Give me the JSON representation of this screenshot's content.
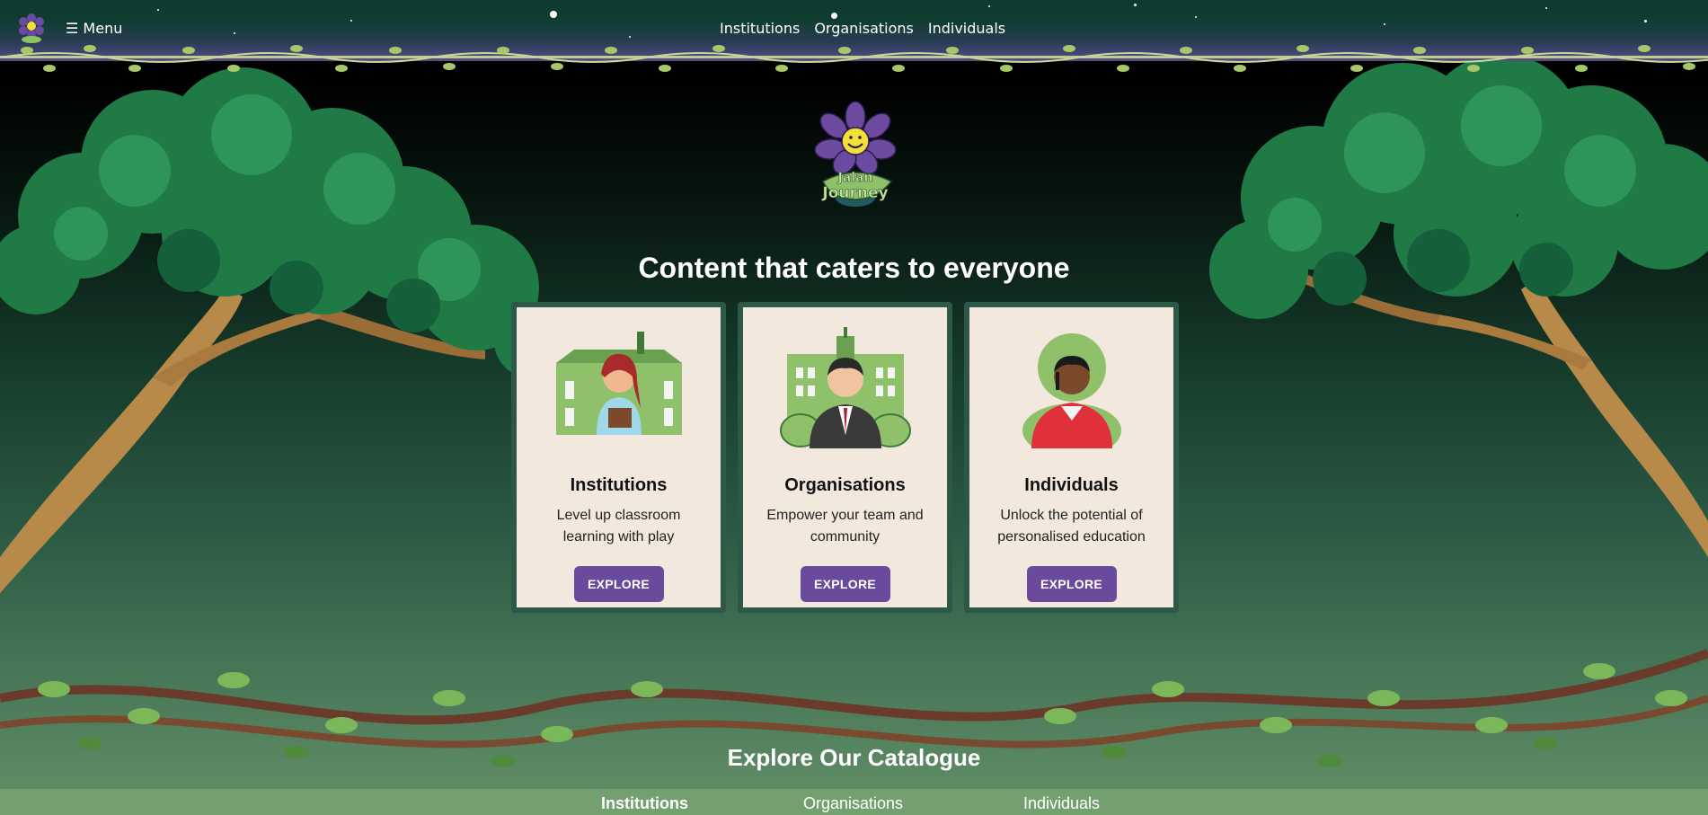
{
  "nav": {
    "menu_label": "☰ Menu",
    "links": [
      "Institutions",
      "Organisations",
      "Individuals"
    ]
  },
  "hero": {
    "logo_text": "Jalan Journey",
    "headline": "Content that caters to everyone"
  },
  "cards": [
    {
      "title": "Institutions",
      "description": "Level up classroom learning with play",
      "button": "EXPLORE"
    },
    {
      "title": "Organisations",
      "description": "Empower your team and community",
      "button": "EXPLORE"
    },
    {
      "title": "Individuals",
      "description": "Unlock the potential of personalised education",
      "button": "EXPLORE"
    }
  ],
  "catalogue": {
    "title": "Explore Our Catalogue",
    "tabs": [
      "Institutions",
      "Organisations",
      "Individuals"
    ],
    "active_tab": "Institutions"
  },
  "colors": {
    "accent_button": "#6a4a9c",
    "card_bg": "#f2e8dd",
    "card_border": "#2d5848"
  }
}
